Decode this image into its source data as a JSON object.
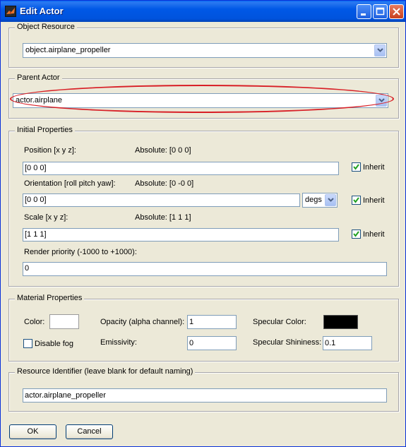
{
  "window": {
    "title": "Edit Actor",
    "icon": "app-icon"
  },
  "object_resource": {
    "group_title": "Object Resource",
    "value": "object.airplane_propeller"
  },
  "parent_actor": {
    "group_title": "Parent Actor",
    "value": "actor.airplane"
  },
  "initial_properties": {
    "group_title": "Initial Properties",
    "position": {
      "label": "Position [x y z]:",
      "absolute": "Absolute: [0 0 0]",
      "value": "[0 0 0]",
      "inherit_label": "Inherit",
      "inherit_checked": true
    },
    "orientation": {
      "label": "Orientation [roll pitch yaw]:",
      "absolute": "Absolute: [0 -0 0]",
      "value": "[0 0 0]",
      "units": "degs",
      "inherit_label": "Inherit",
      "inherit_checked": true
    },
    "scale": {
      "label": "Scale [x y z]:",
      "absolute": "Absolute: [1 1 1]",
      "value": "[1 1 1]",
      "inherit_label": "Inherit",
      "inherit_checked": true
    },
    "render_priority": {
      "label": "Render priority (-1000 to +1000):",
      "value": "0"
    }
  },
  "material_properties": {
    "group_title": "Material Properties",
    "color_label": "Color:",
    "color_value": "#ffffff",
    "disable_fog_label": "Disable fog",
    "disable_fog_checked": false,
    "opacity_label": "Opacity (alpha channel):",
    "opacity_value": "1",
    "emissivity_label": "Emissivity:",
    "emissivity_value": "0",
    "specular_color_label": "Specular Color:",
    "specular_color_value": "#000000",
    "specular_shininess_label": "Specular Shininess:",
    "specular_shininess_value": "0.1"
  },
  "resource_identifier": {
    "group_title": "Resource Identifier (leave blank for default naming)",
    "value": "actor.airplane_propeller"
  },
  "buttons": {
    "ok": "OK",
    "cancel": "Cancel"
  },
  "colors": {
    "annotation": "#d81f26",
    "titlebar": "#0058e6"
  }
}
